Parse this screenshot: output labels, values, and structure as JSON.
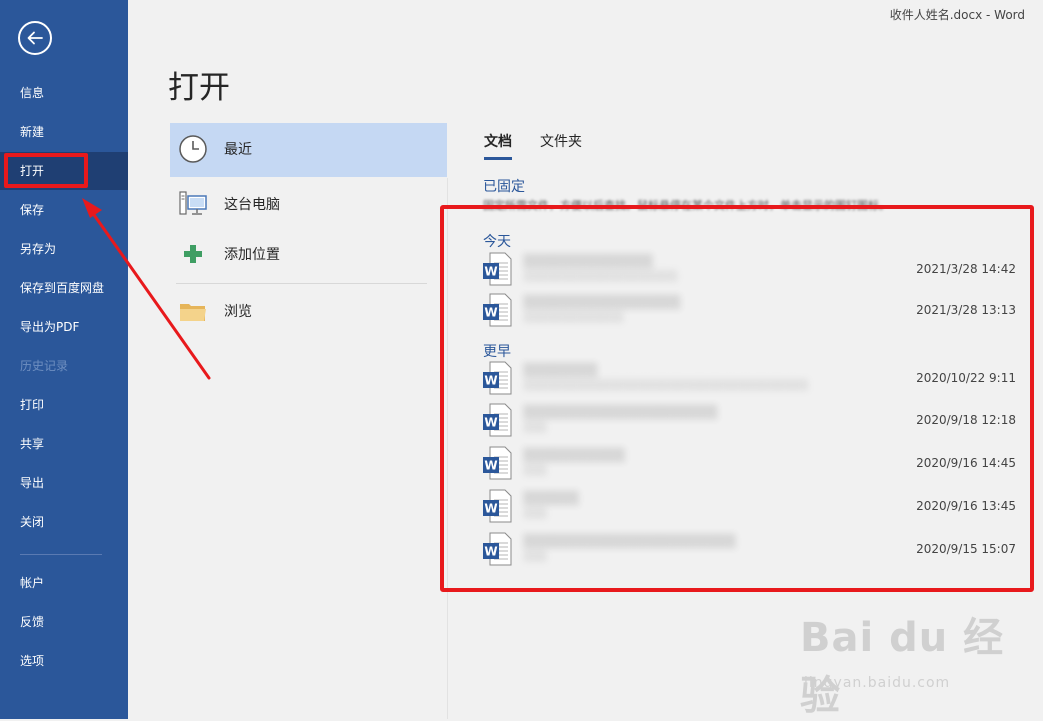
{
  "window_title": "收件人姓名.docx  -  Word",
  "page_title": "打开",
  "nav": {
    "items": [
      {
        "label": "信息",
        "state": "normal"
      },
      {
        "label": "新建",
        "state": "normal"
      },
      {
        "label": "打开",
        "state": "active"
      },
      {
        "label": "保存",
        "state": "normal"
      },
      {
        "label": "另存为",
        "state": "normal"
      },
      {
        "label": "保存到百度网盘",
        "state": "normal"
      },
      {
        "label": "导出为PDF",
        "state": "normal"
      },
      {
        "label": "历史记录",
        "state": "disabled"
      },
      {
        "label": "打印",
        "state": "normal"
      },
      {
        "label": "共享",
        "state": "normal"
      },
      {
        "label": "导出",
        "state": "normal"
      },
      {
        "label": "关闭",
        "state": "normal"
      }
    ],
    "bottom_items": [
      {
        "label": "帐户"
      },
      {
        "label": "反馈"
      },
      {
        "label": "选项"
      }
    ]
  },
  "locations": [
    {
      "label": "最近",
      "icon": "clock-icon",
      "selected": true
    },
    {
      "label": "这台电脑",
      "icon": "computer-icon",
      "selected": false
    },
    {
      "label": "添加位置",
      "icon": "plus-icon",
      "selected": false
    },
    {
      "label": "浏览",
      "icon": "folder-icon",
      "selected": false
    }
  ],
  "tabs": [
    {
      "label": "文档",
      "active": true
    },
    {
      "label": "文件夹",
      "active": false
    }
  ],
  "pinned": {
    "heading": "已固定",
    "hint": "固定所需文件，方便以后查找。鼠标悬停在某个文件上方时，单击显示的图钉图标。"
  },
  "groups": [
    {
      "heading": "今天",
      "documents": [
        {
          "date": "2021/3/28 14:42"
        },
        {
          "date": "2021/3/28 13:13"
        }
      ]
    },
    {
      "heading": "更早",
      "documents": [
        {
          "date": "2020/10/22 9:11"
        },
        {
          "date": "2020/9/18 12:18"
        },
        {
          "date": "2020/9/16 14:45"
        },
        {
          "date": "2020/9/16 13:45"
        },
        {
          "date": "2020/9/15 15:07"
        }
      ]
    }
  ],
  "watermark": {
    "logo": "Bai du 经验",
    "url": "jingyan.baidu.com"
  },
  "colors": {
    "nav_background": "#2b579a",
    "nav_active": "#1f3f73",
    "selected_location": "#c5d8f3",
    "accent_text": "#2b579a",
    "annotation_red": "#e8191c"
  }
}
